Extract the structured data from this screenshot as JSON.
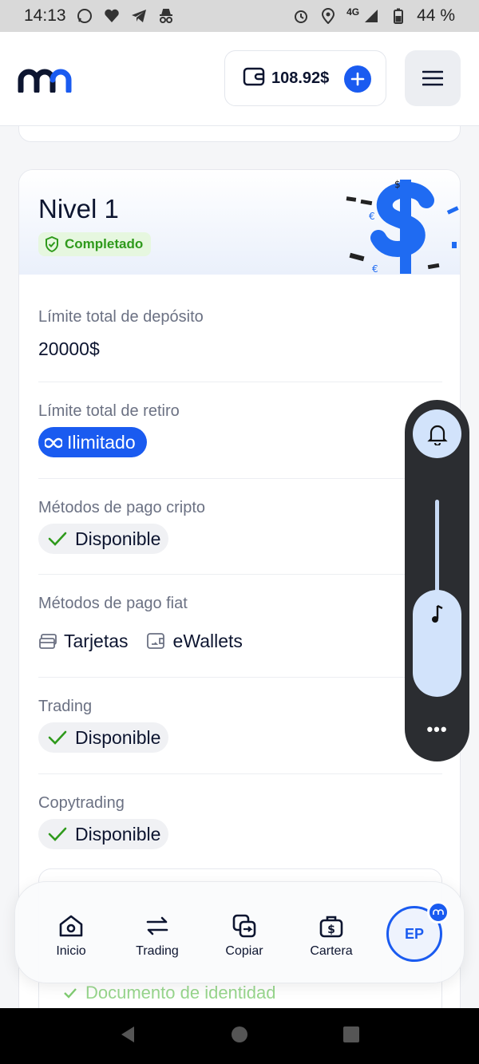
{
  "status_bar": {
    "time": "14:13",
    "network": "4G",
    "battery": "44 %"
  },
  "header": {
    "balance": "108.92$"
  },
  "level_card": {
    "title": "Nivel 1",
    "status": "Completado",
    "rows": [
      {
        "label": "Límite total de depósito",
        "value": "20000$"
      },
      {
        "label": "Límite total de retiro",
        "value": "Ilimitado"
      },
      {
        "label": "Métodos de pago cripto",
        "value": "Disponible"
      },
      {
        "label": "Métodos de pago fiat",
        "methods": [
          "Tarjetas",
          "eWallets"
        ]
      },
      {
        "label": "Trading",
        "value": "Disponible"
      },
      {
        "label": "Copytrading",
        "value": "Disponible"
      }
    ],
    "next_item": "Documento de identidad"
  },
  "bottom_nav": {
    "items": [
      {
        "label": "Inicio",
        "icon": "home-icon"
      },
      {
        "label": "Trading",
        "icon": "swap-icon"
      },
      {
        "label": "Copiar",
        "icon": "copy-icon"
      },
      {
        "label": "Cartera",
        "icon": "wallet-icon"
      }
    ],
    "avatar_initials": "EP"
  },
  "colors": {
    "accent": "#1a5bf0",
    "success": "#2f9a1c",
    "success_bg": "#e6f7df"
  }
}
